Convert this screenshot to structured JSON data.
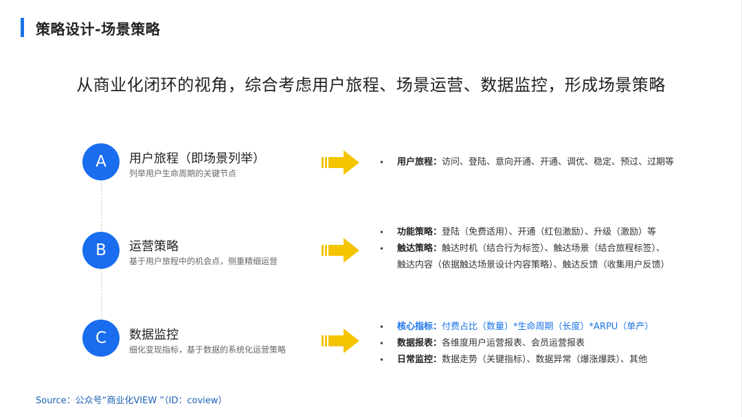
{
  "header": {
    "title": "策略设计-场景策略",
    "accent_color": "#1a73e8"
  },
  "subtitle": "从商业化闭环的视角，综合考虑用户旅程、场景运营、数据监控，形成场景策略",
  "blocks": [
    {
      "letter": "A",
      "title": "用户旅程（即场景列举）",
      "desc": "列举用户生命周期的关键节点",
      "bullets": [
        {
          "label": "用户旅程：",
          "text": "访问、登陆、意向开通、开通、调优、稳定、预过、过期等"
        }
      ]
    },
    {
      "letter": "B",
      "title": "运营策略",
      "desc": "基于用户旅程中的机会点，侧重精细运营",
      "bullets": [
        {
          "label": "功能策略：",
          "text": "登陆（免费适用）、开通（红包激励）、升级（激励）等"
        },
        {
          "label": "触达策略：",
          "text": "触达时机（结合行为标签）、触达场景（结合旅程标签）、",
          "cont": "触达内容（依据触达场景设计内容策略）、触达反馈（收集用户反馈）"
        }
      ]
    },
    {
      "letter": "C",
      "title": "数据监控",
      "desc": "细化变现指标，基于数据的系统化运营策略",
      "bullets": [
        {
          "label": "核心指标：",
          "text": "付费占比（数量）*生命周期（长度）*ARPU（单产）"
        },
        {
          "label": "数据报表：",
          "text": "各维度用户运营报表、会员运营报表"
        },
        {
          "label": "日常监控：",
          "text": "数据走势（关键指标）、数据异常（爆涨爆跌）、其他"
        }
      ]
    }
  ],
  "bullet_glyph": "•",
  "source": "Source：公众号“商业化VIEW ”（ID：coview）",
  "colors": {
    "circle": "#1a6dee",
    "arrow": "#f5c400",
    "highlight": "#1a73e8"
  },
  "icons": [
    "arrow-right-icon"
  ]
}
